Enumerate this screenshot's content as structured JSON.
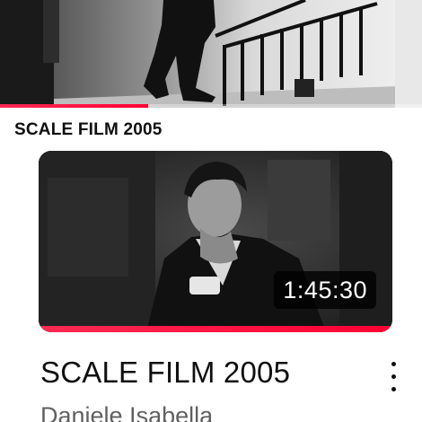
{
  "top_video": {
    "progress_fraction": 0.35
  },
  "section": {
    "title": "SCALE FILM 2005"
  },
  "video": {
    "duration": "1:45:30",
    "progress_fraction": 1.0,
    "title": "SCALE FILM 2005",
    "channel": "Daniele Isabella",
    "menu_icon": "more-vert-icon"
  },
  "colors": {
    "progress_red": "#ff0033",
    "text_primary": "#0f0f0f",
    "text_secondary": "#606060"
  }
}
